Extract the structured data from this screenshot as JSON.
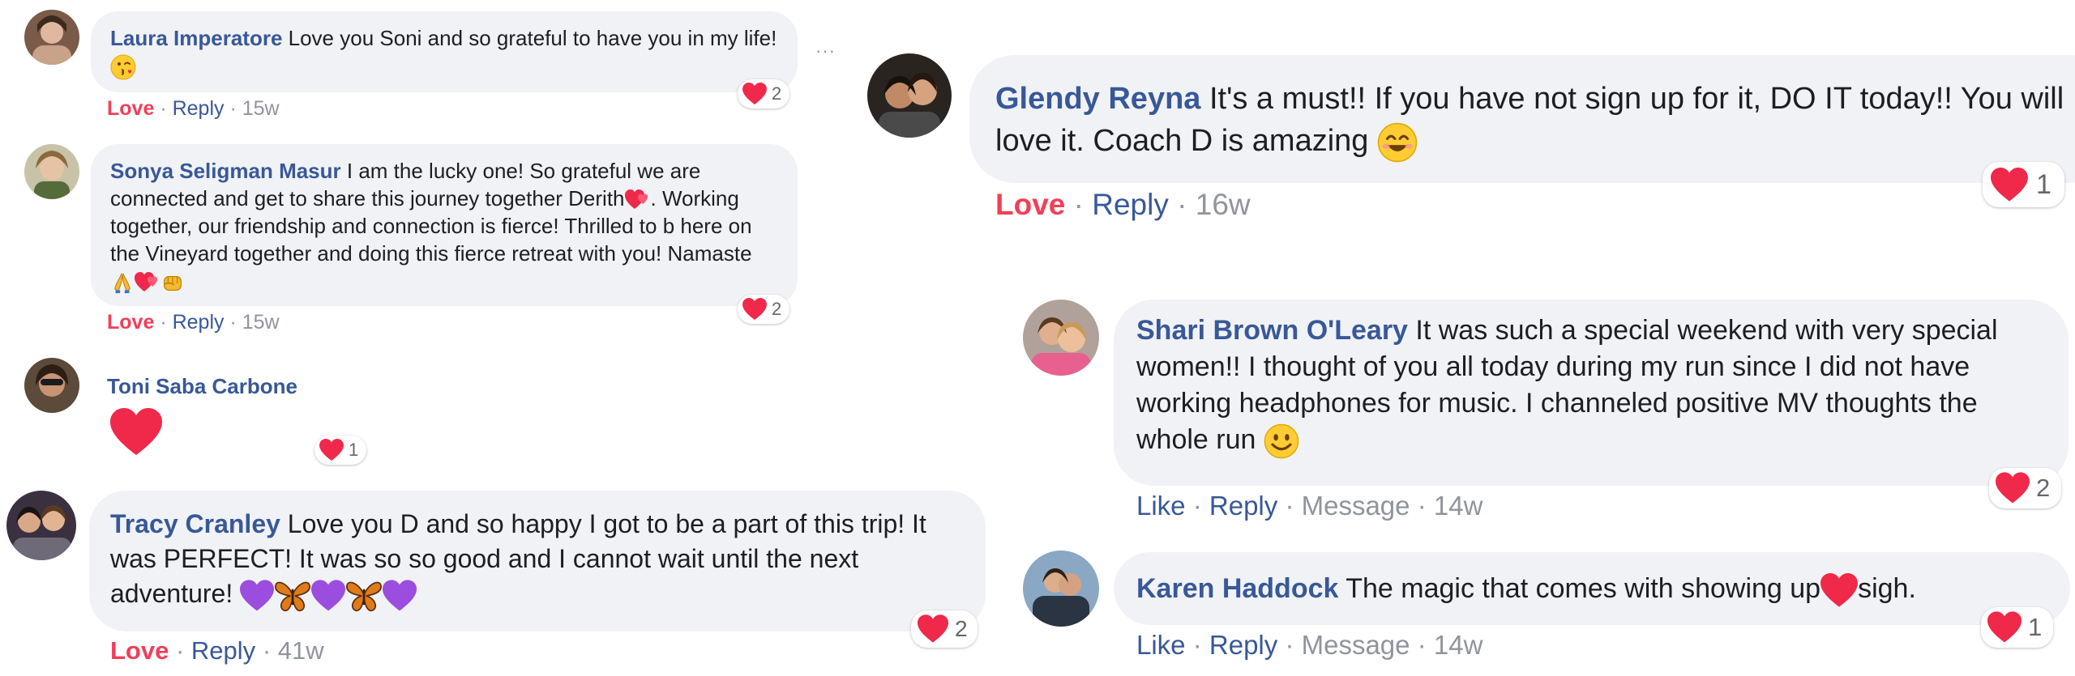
{
  "colors": {
    "name": "#385898",
    "love": "#f33e58",
    "meta": "#90949c",
    "bubble": "#f0f2f5"
  },
  "left": [
    {
      "name": "Laura Imperatore",
      "text": "Love you Soni and so grateful to have you in my life!",
      "action": "Love",
      "reply": "Reply",
      "time": "15w",
      "reactions": "2"
    },
    {
      "name": "Sonya Seligman Masur",
      "text": "I am the lucky one! So grateful we are connected and get to share this journey together Derith",
      "text2": ". Working together, our friendship and connection is fierce! Thrilled to b here on the Vineyard together and doing this fierce retreat with you! Namaste",
      "action": "Love",
      "reply": "Reply",
      "time": "15w",
      "reactions": "2"
    },
    {
      "name": "Toni Saba Carbone",
      "reactions": "1"
    },
    {
      "name": "Tracy Cranley",
      "text": "Love you D and so happy I got to be a part of this trip! It was PERFECT! It was so so good and I cannot wait until the next adventure!",
      "action": "Love",
      "reply": "Reply",
      "time": "41w",
      "reactions": "2"
    }
  ],
  "right": [
    {
      "name": "Glendy Reyna",
      "text": "It's a must!! If you have not sign up for it, DO IT today!! You will love it. Coach D is amazing",
      "action": "Love",
      "reply": "Reply",
      "time": "16w",
      "reactions": "1"
    },
    {
      "name": "Shari Brown O'Leary",
      "text": "It was such a special weekend with very special women!! I thought of you all today during my run since I did not have working headphones for music. I channeled positive MV thoughts the whole run",
      "action": "Like",
      "reply": "Reply",
      "message": "Message",
      "time": "14w",
      "reactions": "2"
    },
    {
      "name": "Karen Haddock",
      "text": "The magic that comes with showing up",
      "text2": "sigh.",
      "action": "Like",
      "reply": "Reply",
      "message": "Message",
      "time": "14w",
      "reactions": "1"
    }
  ],
  "more_options": "···",
  "icons": [
    "heart-icon",
    "kiss-emoji-icon",
    "hearts-emoji-icon",
    "pray-emoji-icon",
    "fist-emoji-icon",
    "purple-heart-icon",
    "butterfly-icon",
    "smile-emoji-icon",
    "more-options-icon"
  ]
}
